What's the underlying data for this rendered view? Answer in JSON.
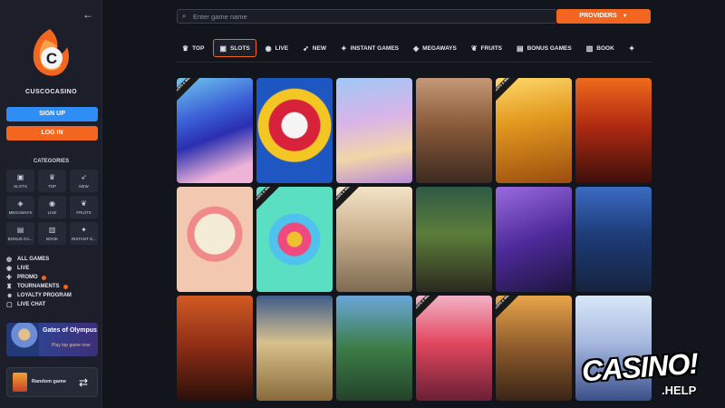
{
  "sidebar": {
    "brand": "CUSCOCASINO",
    "signup_label": "SIGN UP",
    "login_label": "LOG IN",
    "categories_title": "CATEGORIES",
    "categories": [
      {
        "label": "SLOTS",
        "icon": "slots-icon",
        "glyph": "▣"
      },
      {
        "label": "TOP",
        "icon": "crown-icon",
        "glyph": "♛"
      },
      {
        "label": "NEW",
        "icon": "rocket-icon",
        "glyph": "➶"
      },
      {
        "label": "MEGAWAYS",
        "icon": "megaways-icon",
        "glyph": "◈"
      },
      {
        "label": "LIVE",
        "icon": "live-icon",
        "glyph": "◉"
      },
      {
        "label": "FRUITS",
        "icon": "fruit-icon",
        "glyph": "❦"
      },
      {
        "label": "BONUS GA...",
        "icon": "bonus-icon",
        "glyph": "▤"
      },
      {
        "label": "BOOK",
        "icon": "book-icon",
        "glyph": "▥"
      },
      {
        "label": "INSTANT G...",
        "icon": "instant-icon",
        "glyph": "✦"
      }
    ],
    "links": [
      {
        "label": "ALL GAMES",
        "glyph": "◍",
        "dot": false
      },
      {
        "label": "LIVE",
        "glyph": "◉",
        "dot": false
      },
      {
        "label": "PROMO",
        "glyph": "✚",
        "dot": true
      },
      {
        "label": "TOURNAMENTS",
        "glyph": "♜",
        "dot": true
      },
      {
        "label": "LOYALTY PROGRAM",
        "glyph": "☻",
        "dot": false
      },
      {
        "label": "LIVE CHAT",
        "glyph": "▢",
        "dot": false
      }
    ],
    "promo": {
      "title": "Gates of Olympus",
      "subtitle": "Play top game now"
    },
    "random_label": "Random game"
  },
  "search": {
    "placeholder": "Enter game name"
  },
  "providers_label": "PROVIDERS",
  "tabs": [
    {
      "label": "TOP",
      "glyph": "♛",
      "active": false
    },
    {
      "label": "SLOTS",
      "glyph": "▣",
      "active": true
    },
    {
      "label": "LIVE",
      "glyph": "◉",
      "active": false
    },
    {
      "label": "NEW",
      "glyph": "➶",
      "active": false
    },
    {
      "label": "INSTANT GAMES",
      "glyph": "✦",
      "active": false
    },
    {
      "label": "MEGAWAYS",
      "glyph": "◈",
      "active": false
    },
    {
      "label": "FRUITS",
      "glyph": "❦",
      "active": false
    },
    {
      "label": "BONUS GAMES",
      "glyph": "▤",
      "active": false
    },
    {
      "label": "BOOK",
      "glyph": "▥",
      "active": false
    },
    {
      "label": "",
      "glyph": "✦",
      "active": false
    }
  ],
  "games": [
    {
      "badge": "DROPS & WINS",
      "bg": "linear-gradient(160deg,#6fc7f0 0%,#3b5fd6 35%,#2a2fb0 55%,#f0b3d8 85%)"
    },
    {
      "badge": "",
      "bg": "radial-gradient(circle at 50% 45%,#f4f4f4 0 14px,#d8213a 15px 28px,#f3c623 29px 40px,#1f57c2 41px)"
    },
    {
      "badge": "",
      "bg": "linear-gradient(170deg,#9fc8f5 0%,#d9b4e8 40%,#f1d6a8 70%,#b889d9 100%)"
    },
    {
      "badge": "",
      "bg": "linear-gradient(180deg,#c49878 0%,#8a5a3a 45%,#3d2a20 100%)"
    },
    {
      "badge": "DROPS & WINS",
      "bg": "linear-gradient(170deg,#ffd86b 0%,#e29a1f 40%,#9b4d0f 100%)"
    },
    {
      "badge": "",
      "bg": "linear-gradient(180deg,#f06a1c 0%,#b12b12 45%,#3d0f0a 100%)"
    },
    {
      "badge": "",
      "bg": "radial-gradient(circle at 50% 45%,#f5ecd8 0 22px,#f08a8a 23px 30px,#f3c8b0 31px)"
    },
    {
      "badge": "DROPS & WINS",
      "bg": "radial-gradient(circle at 50% 50%,#f0c12e 0 8px,#ef4a7f 9px 18px,#4fc2ee 19px 28px,#5adfc2 29px)"
    },
    {
      "badge": "DROPS & WINS",
      "bg": "linear-gradient(180deg,#f3e3c6 0%,#c9b08e 45%,#7d6b52 100%)"
    },
    {
      "badge": "",
      "bg": "linear-gradient(180deg,#2f5a46 0%,#5c7d3a 45%,#2b2a1f 100%)"
    },
    {
      "badge": "",
      "bg": "linear-gradient(160deg,#9a6be0 0%,#4d2a9a 50%,#1e153f 100%)"
    },
    {
      "badge": "",
      "bg": "linear-gradient(180deg,#3b6bc2 0%,#1e3c7a 45%,#15233f 100%)"
    },
    {
      "badge": "",
      "bg": "linear-gradient(180deg,#d25a23 0%,#8a2c15 50%,#2b0f0a 100%)"
    },
    {
      "badge": "",
      "bg": "linear-gradient(180deg,#3f5d8a 0%,#d8c18e 45%,#8a6a3a 100%)"
    },
    {
      "badge": "",
      "bg": "linear-gradient(180deg,#6aa7d9 0%,#3c7d48 50%,#24422a 100%)"
    },
    {
      "badge": "DROPS & WINS",
      "bg": "linear-gradient(180deg,#f3b2c6 0%,#e1475e 45%,#6a1f35 100%)"
    },
    {
      "badge": "DROPS & WINS",
      "bg": "linear-gradient(180deg,#e8a54a 0%,#8c5a2b 50%,#3a2417 100%)"
    },
    {
      "badge": "",
      "bg": "linear-gradient(180deg,#d9e7f7 0%,#a7b9e0 45%,#3a4f8a 100%)"
    }
  ],
  "watermark": {
    "main": "CASINO!",
    "sub": ".HELP"
  },
  "colors": {
    "accent": "#f2661f",
    "signup": "#2f8ef5",
    "background": "#13151c",
    "sidebar": "#1c1f2a"
  }
}
